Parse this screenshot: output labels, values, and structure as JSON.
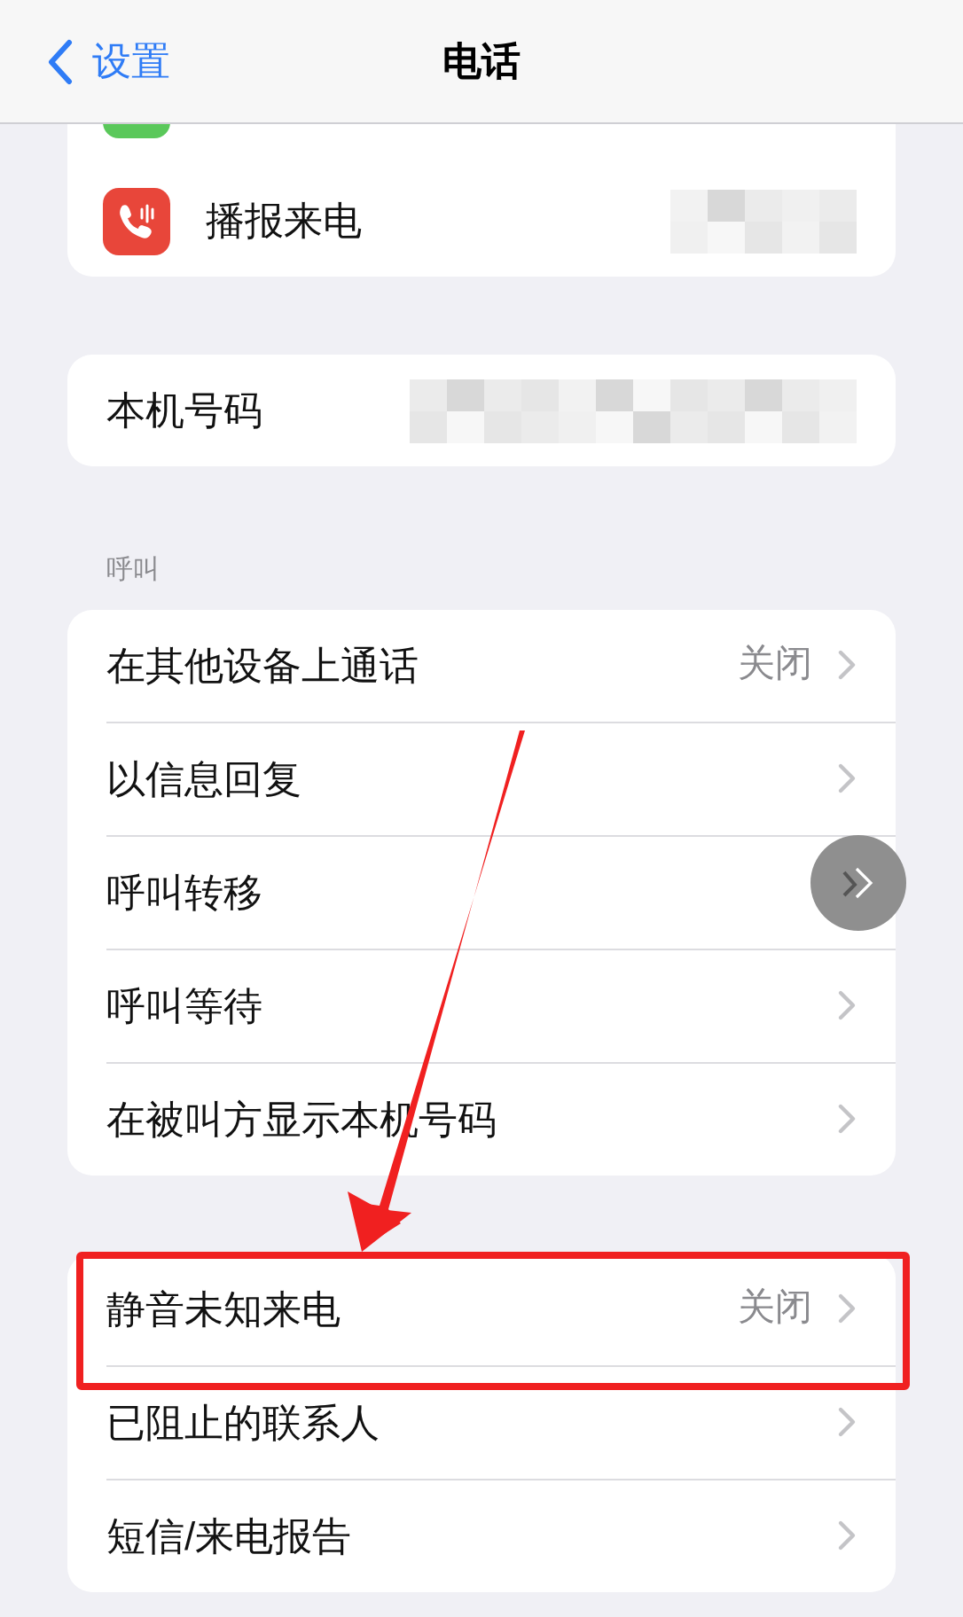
{
  "nav": {
    "back_label": "设置",
    "title": "电话"
  },
  "groups": [
    {
      "top_cut": true,
      "rows": [
        {
          "kind": "icon_hidden",
          "label": "播报来电",
          "highlighted": false
        }
      ]
    },
    {
      "top_cut": false,
      "rows": [
        {
          "kind": "hidden",
          "label": "本机号码",
          "highlighted": false
        }
      ]
    },
    {
      "top_cut": false,
      "header": "呼叫",
      "rows": [
        {
          "kind": "link",
          "label": "在其他设备上通话",
          "value": "关闭",
          "highlighted": false
        },
        {
          "kind": "link",
          "label": "以信息回复",
          "highlighted": false
        },
        {
          "kind": "link",
          "label": "呼叫转移",
          "highlighted": false
        },
        {
          "kind": "link",
          "label": "呼叫等待",
          "highlighted": false
        },
        {
          "kind": "link",
          "label": "在被叫方显示本机号码",
          "highlighted": false
        }
      ]
    },
    {
      "top_cut": false,
      "rows": [
        {
          "kind": "link",
          "label": "静音未知来电",
          "value": "关闭",
          "highlighted": true
        },
        {
          "kind": "link",
          "label": "已阻止的联系人",
          "highlighted": false
        },
        {
          "kind": "link",
          "label": "短信/来电报告",
          "highlighted": false
        }
      ]
    }
  ],
  "annotation_arrow": true,
  "floating_button": true
}
